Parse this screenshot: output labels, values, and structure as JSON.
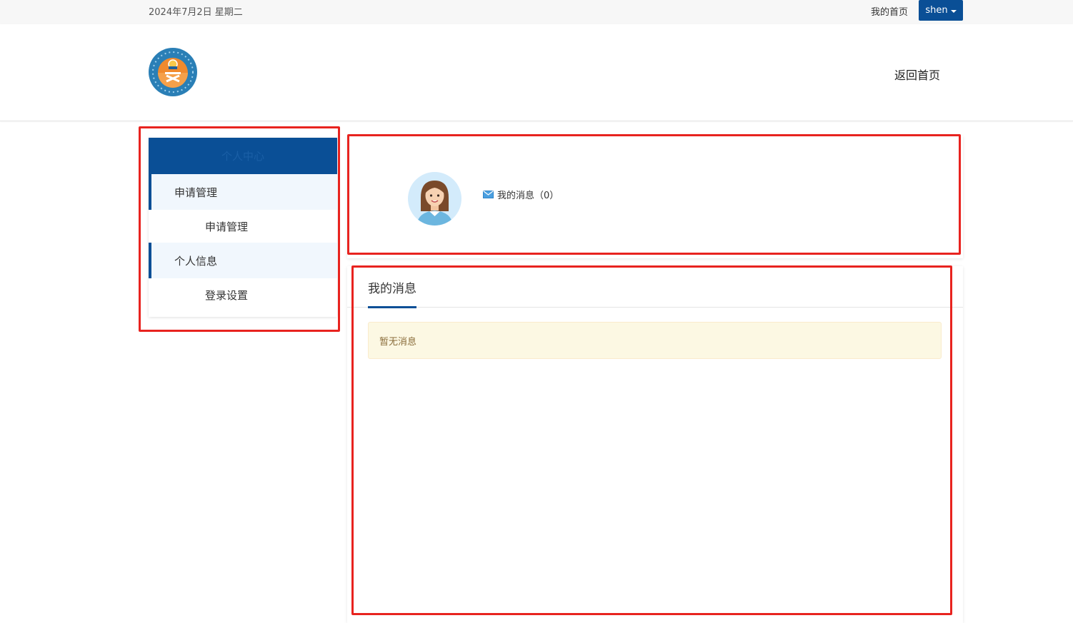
{
  "topbar": {
    "date": "2024年7月2日 星期二",
    "home_link": "我的首页",
    "user_name": "shen"
  },
  "header": {
    "back_home": "返回首页"
  },
  "sidebar": {
    "title": "个人中心",
    "items": [
      {
        "label": "申请管理",
        "type": "group"
      },
      {
        "label": "申请管理",
        "type": "item"
      },
      {
        "label": "个人信息",
        "type": "group"
      },
      {
        "label": "登录设置",
        "type": "item"
      }
    ]
  },
  "profile": {
    "messages_label": "我的消息（0）"
  },
  "messages_panel": {
    "tab_label": "我的消息",
    "empty_text": "暂无消息"
  },
  "colors": {
    "primary": "#0a4f96",
    "highlight_box": "#e8231f",
    "alert_bg": "#fcf8e3"
  }
}
